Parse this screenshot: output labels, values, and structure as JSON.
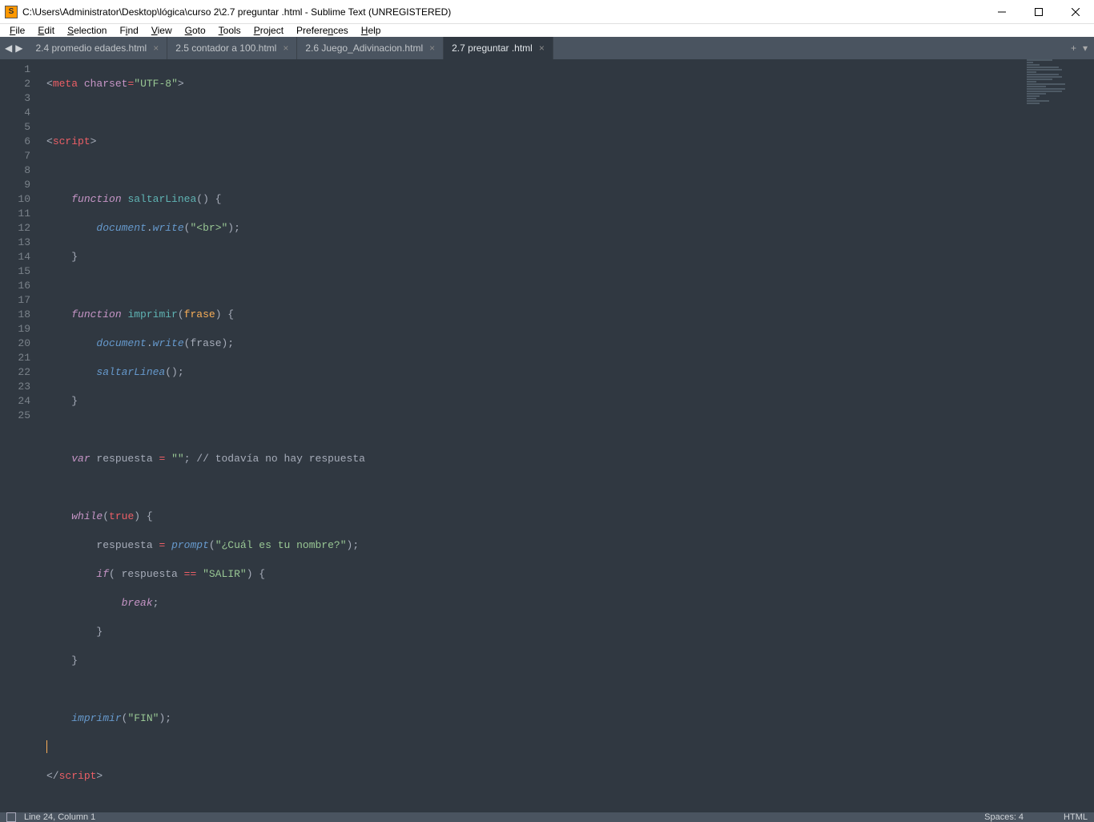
{
  "window": {
    "title": "C:\\Users\\Administrator\\Desktop\\lógica\\curso 2\\2.7 preguntar .html - Sublime Text (UNREGISTERED)"
  },
  "menu": {
    "file": "File",
    "edit": "Edit",
    "selection": "Selection",
    "find": "Find",
    "view": "View",
    "goto": "Goto",
    "tools": "Tools",
    "project": "Project",
    "preferences": "Preferences",
    "help": "Help"
  },
  "tabs": [
    {
      "label": "2.4 promedio edades.html",
      "active": false
    },
    {
      "label": "2.5 contador a 100.html",
      "active": false
    },
    {
      "label": "2.6 Juego_Adivinacion.html",
      "active": false
    },
    {
      "label": "2.7 preguntar .html",
      "active": true
    }
  ],
  "tab_actions": {
    "new": "+",
    "menu": "▾"
  },
  "nav": {
    "back": "◀",
    "forward": "▶"
  },
  "editor": {
    "line_count": 25,
    "modified_lines": [
      18,
      19,
      20
    ],
    "caret_line": 24,
    "code_tokens": {
      "l1": {
        "a": "<",
        "b": "meta",
        "c": " charset",
        "d": "=",
        "e": "\"UTF-8\"",
        "f": ">"
      },
      "l3": {
        "a": "<",
        "b": "script",
        "c": ">"
      },
      "l5": {
        "a": "function",
        "b": " saltarLinea",
        "c": "()",
        "d": " {"
      },
      "l6": {
        "a": "document",
        "b": ".",
        "c": "write",
        "d": "(",
        "e": "\"<br>\"",
        "f": ");"
      },
      "l7": {
        "a": "}"
      },
      "l9": {
        "a": "function",
        "b": " imprimir",
        "c": "(",
        "d": "frase",
        "e": ")",
        "f": " {"
      },
      "l10": {
        "a": "document",
        "b": ".",
        "c": "write",
        "d": "(",
        "e": "frase",
        "f": ");"
      },
      "l11": {
        "a": "saltarLinea",
        "b": "();"
      },
      "l12": {
        "a": "}"
      },
      "l14": {
        "a": "var",
        "b": " respuesta ",
        "c": "=",
        "d": " ",
        "e": "\"\"",
        "f": "; ",
        "g": "// todavía no hay respuesta"
      },
      "l16": {
        "a": "while",
        "b": "(",
        "c": "true",
        "d": ")",
        "e": " {"
      },
      "l17": {
        "a": "respuesta ",
        "b": "=",
        "c": " ",
        "d": "prompt",
        "e": "(",
        "f": "\"¿Cuál es tu nombre?\"",
        "g": ");"
      },
      "l18": {
        "a": "if",
        "b": "( respuesta ",
        "c": "==",
        "d": " ",
        "e": "\"SALIR\"",
        "f": ") {"
      },
      "l19": {
        "a": "break",
        "b": ";"
      },
      "l20": {
        "a": "}"
      },
      "l21": {
        "a": "}"
      },
      "l23": {
        "a": "imprimir",
        "b": "(",
        "c": "\"FIN\"",
        "d": ");"
      },
      "l25": {
        "a": "</",
        "b": "script",
        "c": ">"
      }
    }
  },
  "status": {
    "position": "Line 24, Column 1",
    "spaces": "Spaces: 4",
    "syntax": "HTML"
  }
}
